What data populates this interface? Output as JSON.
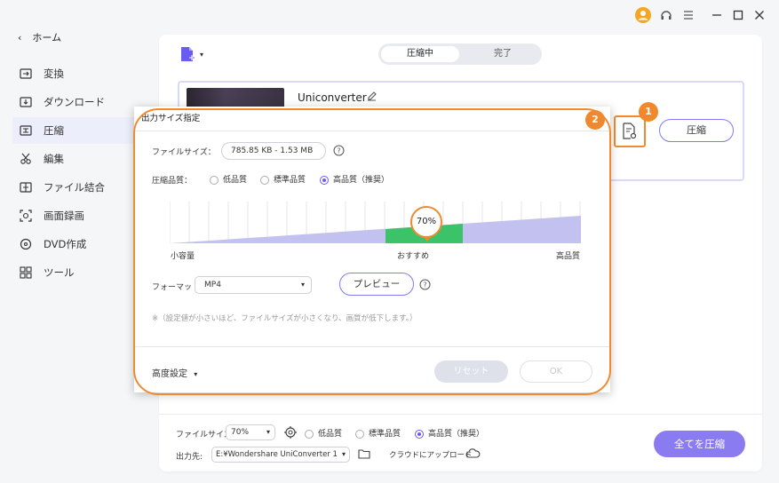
{
  "window": {
    "title_icons": [
      "avatar-icon",
      "headset-icon",
      "menu-icon",
      "minimize-icon",
      "maximize-icon",
      "close-icon"
    ]
  },
  "sidebar": {
    "back_label": "ホーム",
    "items": [
      {
        "label": "変換",
        "icon": "convert-icon"
      },
      {
        "label": "ダウンロード",
        "icon": "download-icon"
      },
      {
        "label": "圧縮",
        "icon": "compress-icon",
        "active": true
      },
      {
        "label": "編集",
        "icon": "edit-icon"
      },
      {
        "label": "ファイル結合",
        "icon": "merge-icon"
      },
      {
        "label": "画面録画",
        "icon": "record-icon"
      },
      {
        "label": "DVD作成",
        "icon": "dvd-icon"
      },
      {
        "label": "ツール",
        "icon": "tools-icon"
      }
    ]
  },
  "tabs": {
    "compressing": "圧縮中",
    "done": "完了"
  },
  "file": {
    "name": "Uniconverter",
    "compress_button": "圧縮"
  },
  "badges": {
    "one": "1",
    "two": "2"
  },
  "dialog": {
    "title": "出力サイズ指定",
    "filesize_label": "ファイルサイズ：",
    "filesize_value": "785.85 KB - 1.53 MB",
    "quality_label": "圧縮品質：",
    "quality_options": [
      "低品質",
      "標準品質",
      "高品質（推奨）"
    ],
    "slider_percent": "70%",
    "slider_value": 0.7,
    "slider_labels": {
      "left": "小容量",
      "mid": "おすすめ",
      "right": "高品質"
    },
    "format_label": "フォーマット:",
    "format_value": "MP4",
    "preview_button": "プレビュー",
    "note": "※（設定値が小さいほど、ファイルサイズが小さくなり、画質が低下します。）",
    "advanced": "高度設定",
    "reset_button": "リセット",
    "ok_button": "OK"
  },
  "bottom": {
    "filesize_label": "ファイルサイズ:",
    "filesize_value": "70%",
    "quality_options": [
      "低品質",
      "標準品質",
      "高品質（推奨）"
    ],
    "output_label": "出力先:",
    "output_value": "E:¥Wondershare UniConverter 1",
    "cloud_upload": "クラウドにアップロード",
    "compress_all": "全てを圧縮"
  },
  "colors": {
    "accent": "#8b7bf0",
    "orange": "#f08a30",
    "green": "#3cc36a",
    "slider_purple": "#c3c1f0"
  }
}
